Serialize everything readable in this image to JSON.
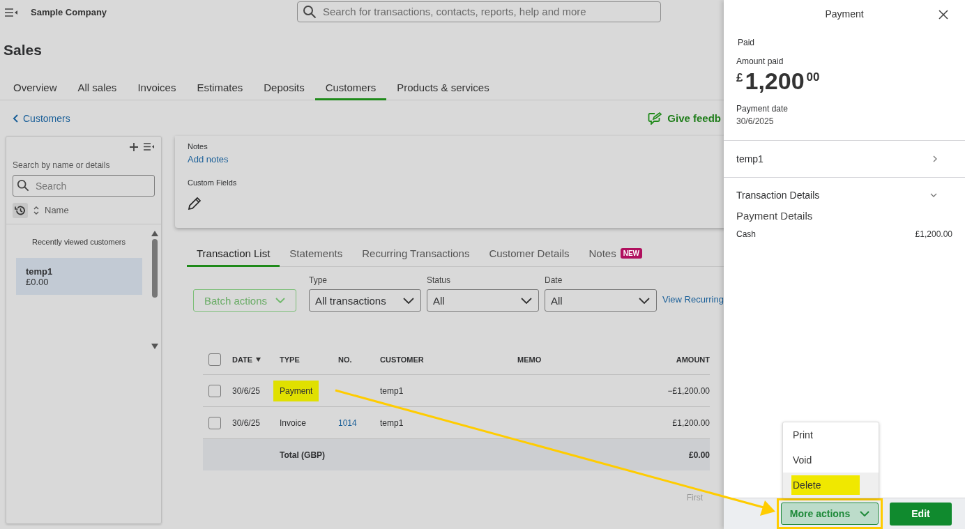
{
  "top_bar": {
    "company": "Sample Company",
    "search": {
      "placeholder": "Search for transactions, contacts, reports, help and more"
    }
  },
  "page_title": "Sales",
  "tabs": [
    {
      "label": "Overview",
      "selected": false
    },
    {
      "label": "All sales",
      "selected": false
    },
    {
      "label": "Invoices",
      "selected": false
    },
    {
      "label": "Estimates",
      "selected": false
    },
    {
      "label": "Deposits",
      "selected": false
    },
    {
      "label": "Customers",
      "selected": true
    },
    {
      "label": "Products & services",
      "selected": false
    }
  ],
  "back_link": "Customers",
  "feedback_link": "Give feedb",
  "customer_panel": {
    "search_label": "Search by name or details",
    "search": {
      "placeholder": "Search"
    },
    "sort_label": "Name",
    "recent_heading": "Recently viewed customers",
    "customers": [
      {
        "name": "temp1",
        "balance": "£0.00",
        "selected": true
      }
    ]
  },
  "customer_card": {
    "notes_label": "Notes",
    "add_notes": "Add notes",
    "custom_fields_label": "Custom Fields"
  },
  "subtabs": [
    {
      "label": "Transaction List",
      "selected": true
    },
    {
      "label": "Statements",
      "selected": false
    },
    {
      "label": "Recurring Transactions",
      "selected": false
    },
    {
      "label": "Customer Details",
      "selected": false
    },
    {
      "label": "Notes",
      "badge": "NEW",
      "selected": false
    }
  ],
  "filters": {
    "batch_button": "Batch actions",
    "selects": [
      {
        "label": "Type",
        "value": "All transactions"
      },
      {
        "label": "Status",
        "value": "All"
      },
      {
        "label": "Date",
        "value": "All"
      }
    ],
    "view_link": "View Recurring"
  },
  "table": {
    "select_all_checked": false,
    "columns": [
      {
        "label": "DATE",
        "sorted": true
      },
      {
        "label": "TYPE",
        "sorted": false
      },
      {
        "label": "NO.",
        "sorted": false
      },
      {
        "label": "CUSTOMER",
        "sorted": false
      },
      {
        "label": "MEMO",
        "sorted": false
      },
      {
        "label": "AMOUNT",
        "sorted": false
      }
    ],
    "rows": [
      {
        "checked": false,
        "date": "30/6/25",
        "type": "Payment",
        "type_highlighted": true,
        "customer": "temp1",
        "amount": "−£1,200.00"
      },
      {
        "checked": false,
        "date": "30/6/25",
        "type": "Invoice",
        "type_highlighted": false,
        "no": "1014",
        "customer": "temp1",
        "amount": "£1,200.00"
      }
    ],
    "total": {
      "label": "Total (GBP)",
      "amount": "£0.00"
    }
  },
  "pagination": "First",
  "drawer": {
    "title": "Payment",
    "status": "Paid",
    "amount_label": "Amount paid",
    "amount": {
      "currency": "£",
      "whole": "1,200",
      "cents": "00"
    },
    "date_label": "Payment date",
    "date": "30/6/2025",
    "customer": "temp1",
    "details_label": "Transaction Details",
    "details_expanded": true,
    "payment_details_heading": "Payment Details",
    "payment_lines": [
      {
        "method": "Cash",
        "amount": "£1,200.00"
      }
    ],
    "menu": [
      {
        "label": "Print",
        "highlighted": false
      },
      {
        "label": "Void",
        "highlighted": false
      },
      {
        "label": "Delete",
        "highlighted": true
      }
    ],
    "more_button": {
      "label": "More actions",
      "expanded": true,
      "annotated": true
    },
    "edit_button": "Edit"
  }
}
